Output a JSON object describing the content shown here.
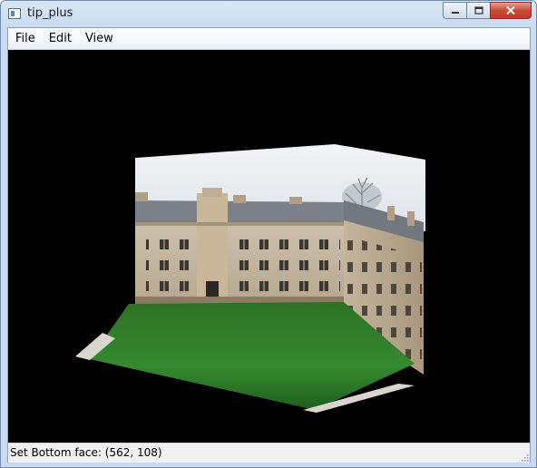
{
  "window": {
    "title": "tip_plus"
  },
  "menu": {
    "file": "File",
    "edit": "Edit",
    "view": "View"
  },
  "status": {
    "text": "Set Bottom face: (562, 108)"
  },
  "icons": {
    "app": "app-icon",
    "minimize": "minimize-icon",
    "maximize": "maximize-icon",
    "close": "close-icon",
    "grip": "resize-grip-icon"
  },
  "colors": {
    "canvas_bg": "#000000",
    "close_btn": "#c74a37",
    "sky": "#e9ecef",
    "stone": "#c7b8a1",
    "roof": "#7d8088",
    "grass": "#2f7a2b"
  }
}
